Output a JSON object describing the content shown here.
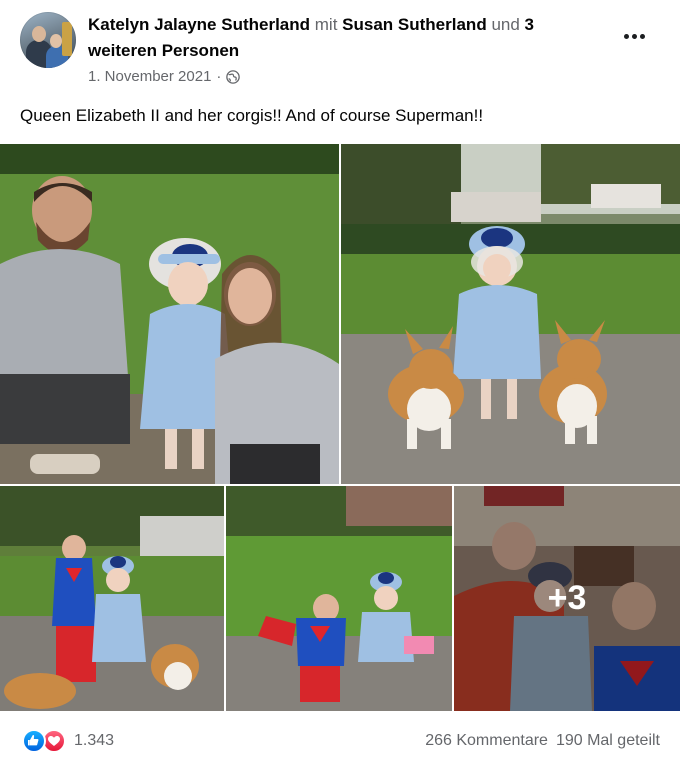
{
  "post": {
    "author": "Katelyn Jalayne Sutherland",
    "with_word": "mit",
    "tagged_person": "Susan Sutherland",
    "and_word": "und",
    "others": "3 weiteren Personen",
    "date": "1. November 2021",
    "separator": "·",
    "privacy_icon": "globe-icon",
    "menu_icon": "more-options-icon",
    "caption": "Queen Elizabeth II and her corgis!! And of course Superman!!"
  },
  "photos": {
    "extra_count": "+3"
  },
  "footer": {
    "reaction_icons": [
      "like-icon",
      "love-icon"
    ],
    "reaction_count": "1.343",
    "comments": "266 Kommentare",
    "shares": "190 Mal geteilt"
  },
  "colors": {
    "text_primary": "#050505",
    "text_secondary": "#65676b",
    "like_blue": "#0062df",
    "love_red": "#e61739"
  }
}
